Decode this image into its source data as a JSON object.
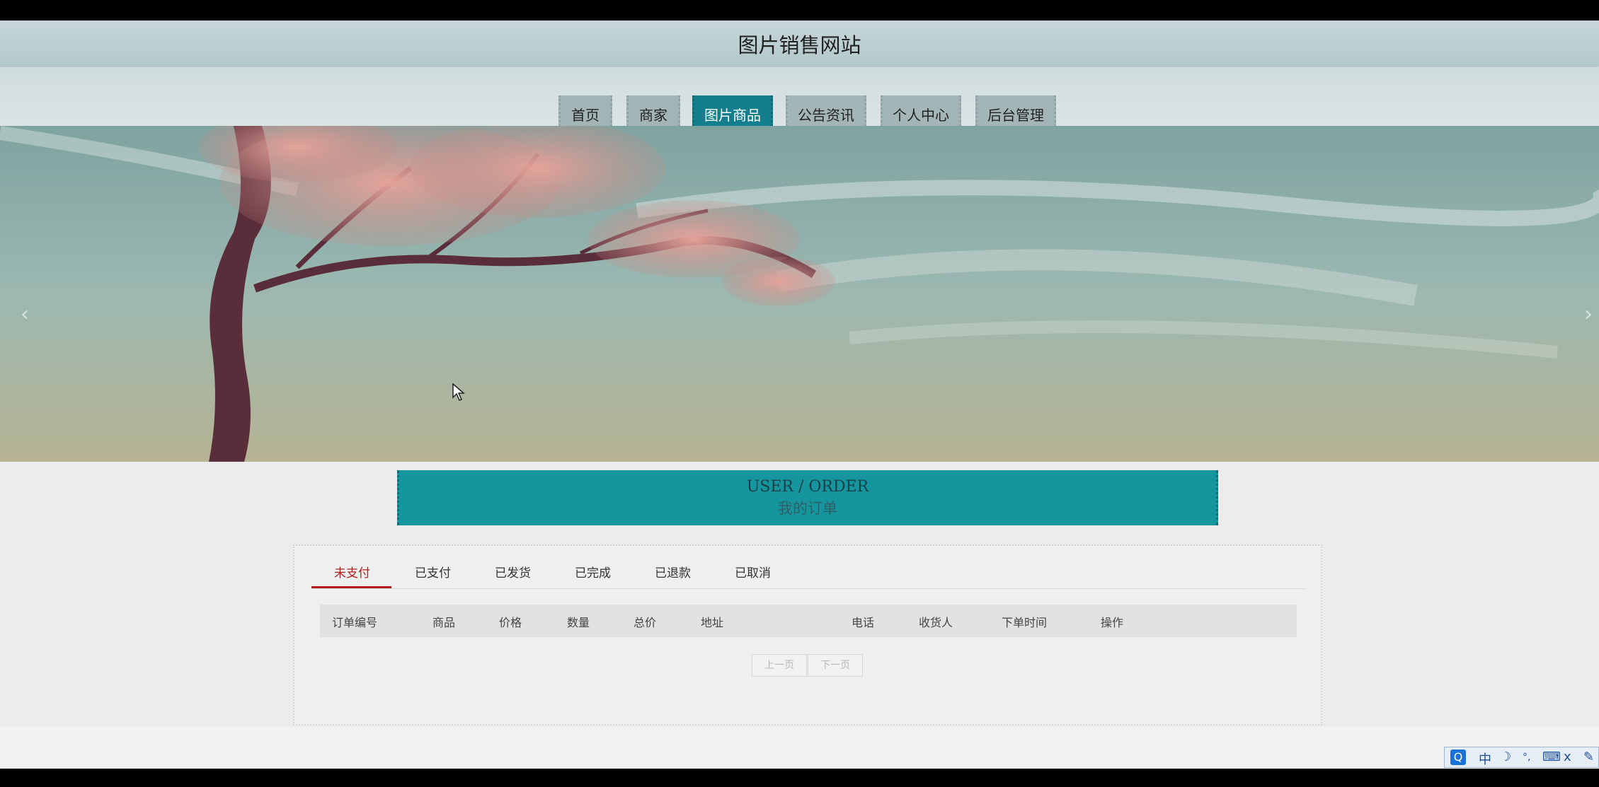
{
  "site": {
    "title": "图片销售网站"
  },
  "nav": {
    "items": [
      {
        "label": "首页"
      },
      {
        "label": "商家"
      },
      {
        "label": "图片商品",
        "active": true
      },
      {
        "label": "公告资讯"
      },
      {
        "label": "个人中心"
      },
      {
        "label": "后台管理"
      }
    ]
  },
  "banner": {
    "prev_icon": "chevron-left-icon",
    "next_icon": "chevron-right-icon",
    "prev_glyph": "‹",
    "next_glyph": "›"
  },
  "order_header": {
    "en": "USER / ORDER",
    "cn": "我的订单"
  },
  "order_tabs": [
    {
      "label": "未支付",
      "active": true
    },
    {
      "label": "已支付"
    },
    {
      "label": "已发货"
    },
    {
      "label": "已完成"
    },
    {
      "label": "已退款"
    },
    {
      "label": "已取消"
    }
  ],
  "table": {
    "columns": [
      "订单编号",
      "商品",
      "价格",
      "数量",
      "总价",
      "地址",
      "电话",
      "收货人",
      "下单时间",
      "操作"
    ]
  },
  "pager": {
    "prev": "上一页",
    "next": "下一页"
  },
  "ime": {
    "q": "Q",
    "mode": "中",
    "moon": "☽",
    "punct": "°,",
    "keyboard": "⌨",
    "split": "ⅹ",
    "tools": "✎"
  },
  "colors": {
    "accent": "#147f8c",
    "active_tab": "#b01e1e",
    "order_banner": "#15969f"
  }
}
